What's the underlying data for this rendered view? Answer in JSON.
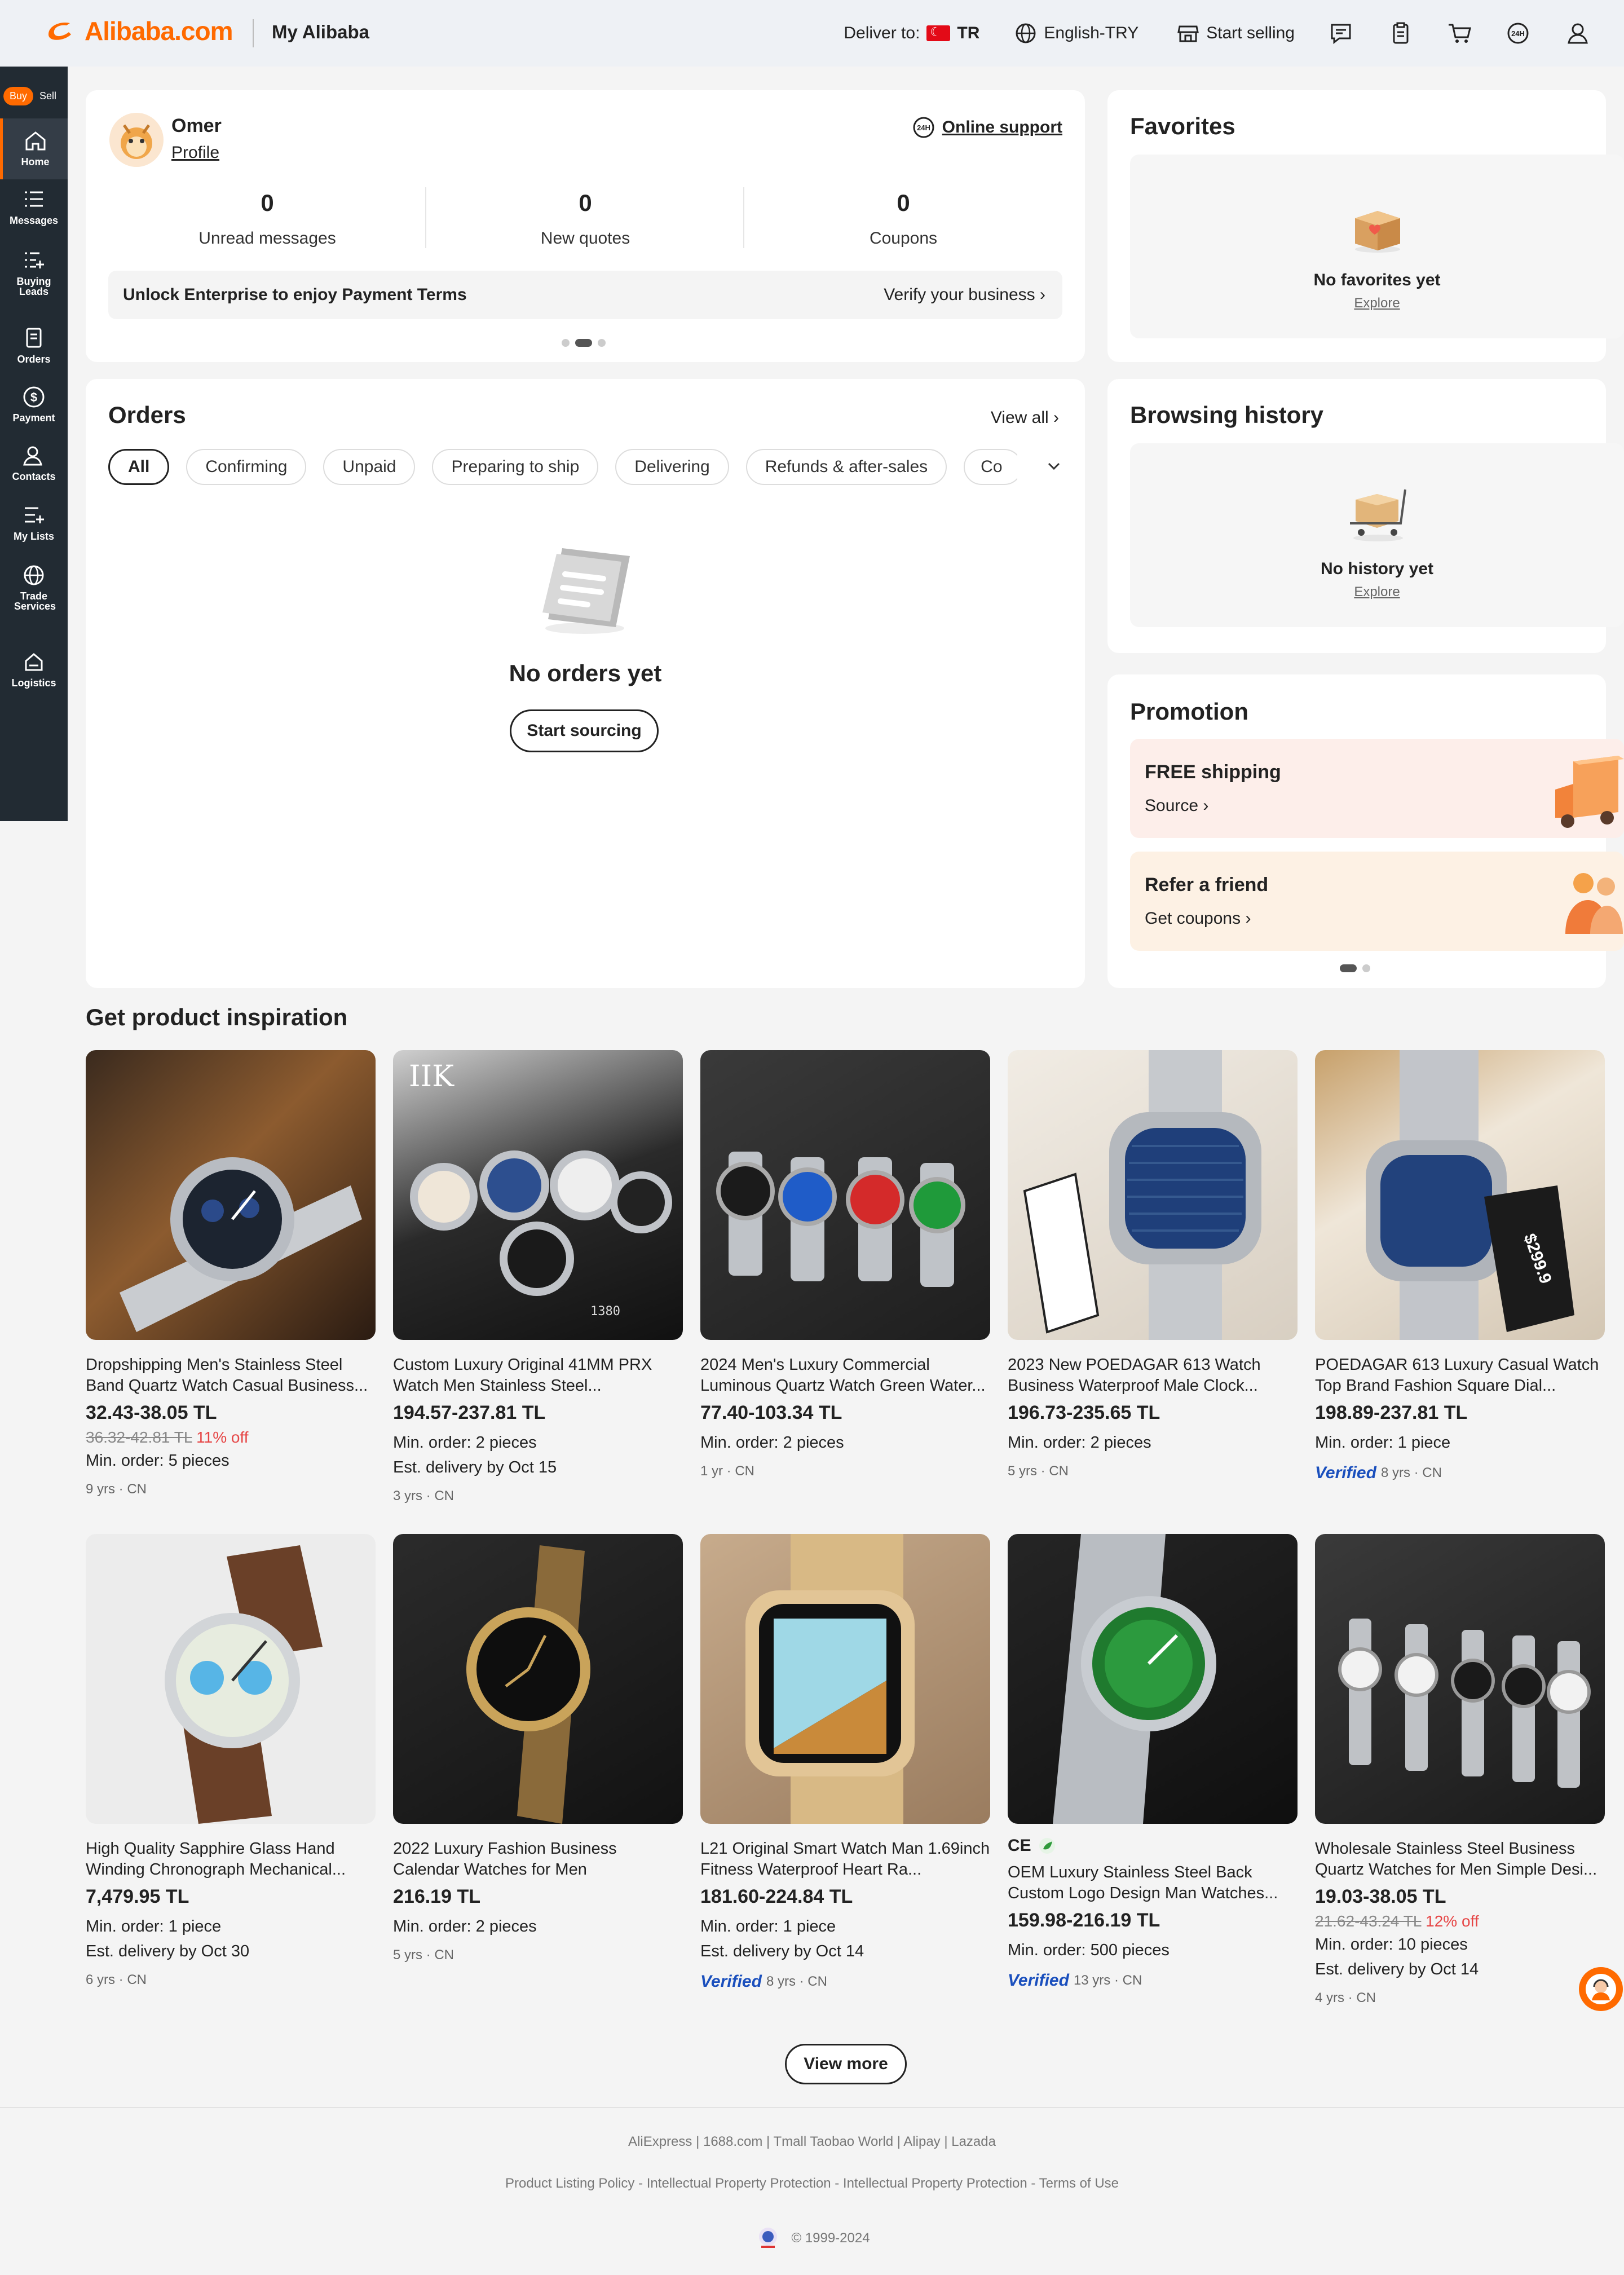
{
  "header": {
    "logo_text": "Alibaba.com",
    "section": "My Alibaba",
    "deliver_label": "Deliver to:",
    "deliver_country": "TR",
    "language": "English-TRY",
    "start_selling": "Start selling",
    "accent": "#ff6a00"
  },
  "sidebar": {
    "buy": "Buy",
    "sell": "Sell",
    "items": [
      {
        "label": "Home",
        "icon": "home-icon"
      },
      {
        "label": "Messages",
        "icon": "messages-icon"
      },
      {
        "label": "Buying Leads",
        "icon": "buying-leads-icon"
      },
      {
        "label": "Orders",
        "icon": "orders-icon"
      },
      {
        "label": "Payment",
        "icon": "payment-icon"
      },
      {
        "label": "Contacts",
        "icon": "contacts-icon"
      },
      {
        "label": "My Lists",
        "icon": "my-lists-icon"
      },
      {
        "label": "Trade Services",
        "icon": "globe-icon"
      },
      {
        "label": "Logistics",
        "icon": "logistics-icon"
      }
    ]
  },
  "profile": {
    "name": "Omer",
    "profile_link": "Profile",
    "support": "Online support",
    "stats": [
      {
        "value": "0",
        "label": "Unread messages"
      },
      {
        "value": "0",
        "label": "New quotes"
      },
      {
        "value": "0",
        "label": "Coupons"
      }
    ],
    "banner_text": "Unlock Enterprise to enjoy Payment Terms",
    "banner_action": "Verify your business"
  },
  "orders": {
    "title": "Orders",
    "view_all": "View all",
    "tabs": [
      "All",
      "Confirming",
      "Unpaid",
      "Preparing to ship",
      "Delivering",
      "Refunds & after-sales",
      "Co"
    ],
    "empty": "No orders yet",
    "cta": "Start sourcing"
  },
  "favorites": {
    "title": "Favorites",
    "empty": "No favorites yet",
    "explore": "Explore"
  },
  "history": {
    "title": "Browsing history",
    "empty": "No history yet",
    "explore": "Explore"
  },
  "promotion": {
    "title": "Promotion",
    "items": [
      {
        "title": "FREE shipping",
        "action": "Source",
        "bg": "#fdeeea"
      },
      {
        "title": "Refer a friend",
        "action": "Get coupons",
        "bg": "#fdf1e4"
      }
    ]
  },
  "inspiration": {
    "title": "Get product inspiration",
    "products": [
      {
        "name": "Dropshipping Men's Stainless Steel Band Quartz Watch Casual Business...",
        "price": "32.43-38.05 TL",
        "old": "36.32-42.81 TL",
        "off": "11% off",
        "lines": [
          "Min. order: 5 pieces"
        ],
        "verified": "",
        "meta": "9 yrs · CN"
      },
      {
        "name": "Custom Luxury Original 41MM PRX Watch Men Stainless Steel...",
        "price": "194.57-237.81 TL",
        "old": "",
        "off": "",
        "lines": [
          "Min. order: 2 pieces",
          "Est. delivery by Oct 15"
        ],
        "verified": "",
        "meta": "3 yrs · CN"
      },
      {
        "name": "2024 Men's Luxury Commercial Luminous Quartz Watch Green Water...",
        "price": "77.40-103.34 TL",
        "old": "",
        "off": "",
        "lines": [
          "Min. order: 2 pieces"
        ],
        "verified": "",
        "meta": "1 yr · CN"
      },
      {
        "name": "2023 New POEDAGAR 613 Watch Business Waterproof Male Clock...",
        "price": "196.73-235.65 TL",
        "old": "",
        "off": "",
        "lines": [
          "Min. order: 2 pieces"
        ],
        "verified": "",
        "meta": "5 yrs · CN"
      },
      {
        "name": "POEDAGAR 613 Luxury Casual Watch Top Brand Fashion Square Dial...",
        "price": "198.89-237.81 TL",
        "old": "",
        "off": "",
        "lines": [
          "Min. order: 1 piece"
        ],
        "verified": "Verified",
        "meta": "8 yrs · CN"
      },
      {
        "name": "High Quality Sapphire Glass Hand Winding Chronograph Mechanical...",
        "price": "7,479.95 TL",
        "old": "",
        "off": "",
        "lines": [
          "Min. order: 1 piece",
          "Est. delivery by Oct 30"
        ],
        "verified": "",
        "meta": "6 yrs · CN"
      },
      {
        "name": "2022 Luxury Fashion Business Calendar Watches for Men",
        "price": "216.19 TL",
        "old": "",
        "off": "",
        "lines": [
          "Min. order: 2 pieces"
        ],
        "verified": "",
        "meta": "5 yrs · CN"
      },
      {
        "name": "L21 Original Smart Watch Man 1.69inch Fitness Waterproof Heart Ra...",
        "price": "181.60-224.84 TL",
        "old": "",
        "off": "",
        "lines": [
          "Min. order: 1 piece",
          "Est. delivery by Oct 14"
        ],
        "verified": "Verified",
        "meta": "8 yrs · CN"
      },
      {
        "name": "OEM Luxury Stainless Steel Back Custom Logo Design Man Watches...",
        "price": "159.98-216.19 TL",
        "old": "",
        "off": "",
        "lines": [
          "Min. order: 500 pieces"
        ],
        "verified": "Verified",
        "meta": "13 yrs · CN",
        "cert": "CE"
      },
      {
        "name": "Wholesale Stainless Steel Business Quartz Watches for Men Simple Desi...",
        "price": "19.03-38.05 TL",
        "old": "21.62-43.24 TL",
        "off": "12% off",
        "lines": [
          "Min. order: 10 pieces",
          "Est. delivery by Oct 14"
        ],
        "verified": "",
        "meta": "4 yrs · CN"
      }
    ],
    "view_more": "View more"
  },
  "footer": {
    "links1": "AliExpress | 1688.com | Tmall Taobao World | Alipay | Lazada",
    "links2": "Product Listing Policy - Intellectual Property Protection - Intellectual Property Protection - Terms of Use",
    "copyright": "© 1999-2024"
  }
}
